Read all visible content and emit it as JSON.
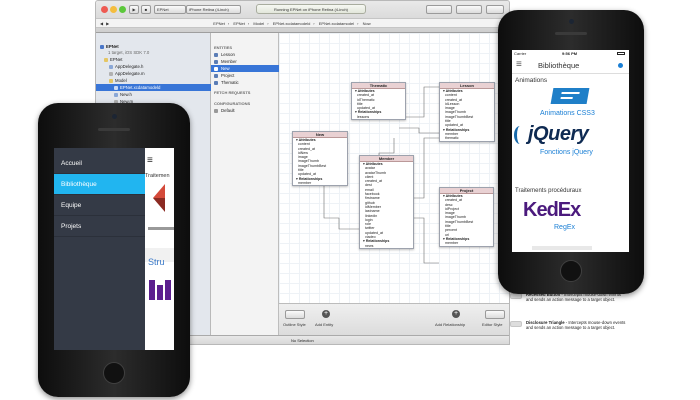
{
  "xcode": {
    "scheme": "EPNet",
    "device": "iPhone Retina (4-inch)",
    "status": "Running EPNet on iPhone Retina (4-inch)",
    "jumpbar": [
      "EPNet",
      "EPNet",
      "Model",
      "EPNet.xcdatamodeld",
      "EPNet.xcdatamodel",
      "Now"
    ],
    "navigator": [
      {
        "label": "EPNet",
        "level": 0,
        "bold": true
      },
      {
        "label": "1 target, iOS SDK 7.0",
        "level": 1,
        "bold": false
      },
      {
        "label": "EPNet",
        "level": 1,
        "bold": false
      },
      {
        "label": "AppDelegate.h",
        "level": 2,
        "bold": false
      },
      {
        "label": "AppDelegate.m",
        "level": 2,
        "bold": false
      },
      {
        "label": "Model",
        "level": 2,
        "bold": false
      },
      {
        "label": "EPNet.xcdatamodeld",
        "level": 3,
        "bold": false,
        "selected": true
      },
      {
        "label": "New.h",
        "level": 3,
        "bold": false
      },
      {
        "label": "New.m",
        "level": 3,
        "bold": false
      },
      {
        "label": "Lesson.h",
        "level": 3,
        "bold": false
      },
      {
        "label": "Lesson.m",
        "level": 3,
        "bold": false
      }
    ],
    "entities_header": "ENTITIES",
    "entities": [
      "Lesson",
      "Member",
      "New",
      "Project",
      "Thematic"
    ],
    "fetch_header": "FETCH REQUESTS",
    "configs_header": "CONFIGURATIONS",
    "configs": [
      "Default"
    ],
    "outline_style": "Outline Style",
    "add_entity": "Add Entity",
    "add_relationship": "Add Relationship",
    "editor_style": "Editor Style",
    "no_selection": "No Selection"
  },
  "diagram": {
    "thematic": {
      "name": "Thematic",
      "attr_header": "Attributes",
      "fields": [
        "created_at",
        "idThematic",
        "title",
        "updated_at"
      ],
      "rel_header": "Relationships",
      "rels": [
        "lessons"
      ]
    },
    "lesson": {
      "name": "Lesson",
      "attr_header": "Attributes",
      "fields": [
        "content",
        "created_at",
        "idLesson",
        "image",
        "imageThumb",
        "imageThumbBest",
        "title",
        "updated_at"
      ],
      "rel_header": "Relationships",
      "rels": [
        "member",
        "thematic"
      ]
    },
    "new": {
      "name": "New",
      "attr_header": "Attributes",
      "fields": [
        "content",
        "created_at",
        "idNew",
        "image",
        "imageThumb",
        "imageThumbBest",
        "title",
        "updated_at"
      ],
      "rel_header": "Relationships",
      "rels": [
        "member"
      ]
    },
    "member": {
      "name": "Member",
      "attr_header": "Attributes",
      "fields": [
        "avatar",
        "avatarThumb",
        "client",
        "created_at",
        "dest",
        "email",
        "facebook",
        "firstname",
        "github",
        "idMember",
        "lastname",
        "linkedin",
        "login",
        "role",
        "twitter",
        "updated_at",
        "viadeo"
      ],
      "rel_header": "Relationships",
      "rels": [
        "news"
      ]
    },
    "project": {
      "name": "Project",
      "attr_header": "Attributes",
      "fields": [
        "created_at",
        "desc",
        "idProject",
        "image",
        "imageThumb",
        "imageThumbBest",
        "title",
        "percent",
        "url"
      ],
      "rel_header": "Relationships",
      "rels": [
        "member"
      ]
    }
  },
  "left_phone": {
    "menu": [
      "Accueil",
      "Bibliothèque",
      "Equipe",
      "Projets"
    ],
    "active_index": 1,
    "peek_label": "Traitemen",
    "peek_text": "Stru"
  },
  "right_phone": {
    "carrier": "Carrier",
    "time": "9:56 PM",
    "title": "Bibliothèque",
    "section1": "Animations",
    "item1_caption": "Animations CSS3",
    "jquery_logo": "jQuery",
    "item2_caption": "Fonctions jQuery",
    "section2": "Traitements procéduraux",
    "kedex_logo": "KedEx",
    "item3_caption": "RegEx",
    "accent": "#1a7fd5"
  },
  "object_list": [
    {
      "title": "",
      "desc": "action message to a target object."
    },
    {
      "title": "Recessed Button",
      "desc": "Intercepts mouse-down events and sends an action message to a target object."
    },
    {
      "title": "Disclosure Triangle",
      "desc": "Intercepts mouse-down events and sends an action message to a target object."
    }
  ]
}
